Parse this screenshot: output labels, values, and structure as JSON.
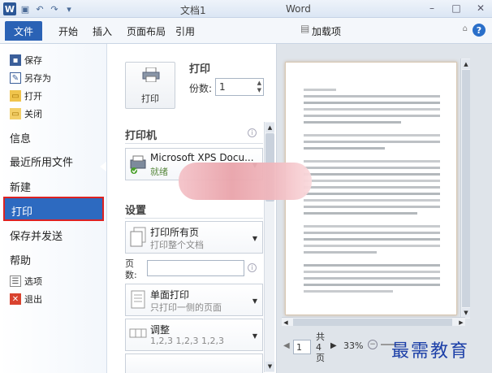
{
  "window": {
    "title": "文档1",
    "app": "Word",
    "logo_letter": "W",
    "qat": [
      "save-icon",
      "undo-icon",
      "redo-icon",
      "customize-icon"
    ]
  },
  "ribbon": {
    "file_tab": "文件",
    "tabs": [
      "开始",
      "插入",
      "页面布局",
      "引用",
      "加载项"
    ]
  },
  "nav": {
    "save": "保存",
    "save_as": "另存为",
    "open": "打开",
    "close": "关闭",
    "info": "信息",
    "recent": "最近所用文件",
    "new": "新建",
    "print": "打印",
    "save_send": "保存并发送",
    "help": "帮助",
    "options": "选项",
    "exit": "退出"
  },
  "print": {
    "button_label": "打印",
    "title": "打印",
    "copies_label": "份数:",
    "copies_value": "1"
  },
  "printer": {
    "section": "打印机",
    "name": "Microsoft XPS Docu...",
    "status": "就绪"
  },
  "settings": {
    "section": "设置",
    "range_main": "打印所有页",
    "range_sub": "打印整个文档",
    "pages_label": "页数:",
    "sides_main": "单面打印",
    "sides_sub": "只打印一侧的页面",
    "collate_main": "调整",
    "collate_sub": "1,2,3    1,2,3    1,2,3"
  },
  "preview": {
    "page_number": "1",
    "total_pages": "共 4 页",
    "zoom": "33%"
  },
  "watermark": "最需教育",
  "colors": {
    "file_tab": "#2a62b5",
    "nav_active": "#2d6ac0",
    "highlight_border": "#dd2222"
  }
}
